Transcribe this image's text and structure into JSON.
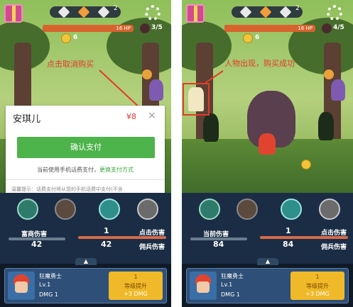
{
  "colors": {
    "annotation": "#e53a2a",
    "pay_button": "#4db34b",
    "price": "#e3342f",
    "upgrade": "#f0b929"
  },
  "left": {
    "hud": {
      "stage_next": "2",
      "hp_text": "16 HP",
      "hp_fraction": 1.0,
      "coins": "6",
      "kills": "3/5"
    },
    "annotation": "点击取消购买",
    "dialog": {
      "title": "安琪儿",
      "price": "¥8",
      "close": "×",
      "pay_button": "确认支付",
      "info_prefix": "当前使用手机话费支付，",
      "info_link": "更换支付方式",
      "note": "温馨提示：话费支付将从您的手机话费中支付(不含"
    },
    "stats": {
      "left_label": "富商伤害",
      "left_value": "42",
      "click_value": "1",
      "click_label": "点击伤害",
      "team_value": "42",
      "team_label": "佣兵伤害"
    },
    "hero": {
      "name": "狂魔勇士",
      "level": "Lv.1",
      "dmg": "DMG 1",
      "upgrade_cost": "1",
      "upgrade_label": "等级提升",
      "upgrade_dmg": "+3 DMG"
    },
    "chevron": "▲"
  },
  "right": {
    "hud": {
      "stage_next": "2",
      "hp_text": "16 HP",
      "hp_fraction": 1.0,
      "coins": "6",
      "kills": "4/5"
    },
    "annotation": "人物出现，购买成功",
    "stats": {
      "left_label": "当前伤害",
      "left_value": "84",
      "click_value": "1",
      "click_label": "点击伤害",
      "team_value": "84",
      "team_label": "佣兵伤害"
    },
    "hero": {
      "name": "狂魔勇士",
      "level": "Lv.1",
      "dmg": "DMG 1",
      "upgrade_cost": "1",
      "upgrade_label": "等级提升",
      "upgrade_dmg": "+3 DMG"
    },
    "chevron": "▲"
  }
}
